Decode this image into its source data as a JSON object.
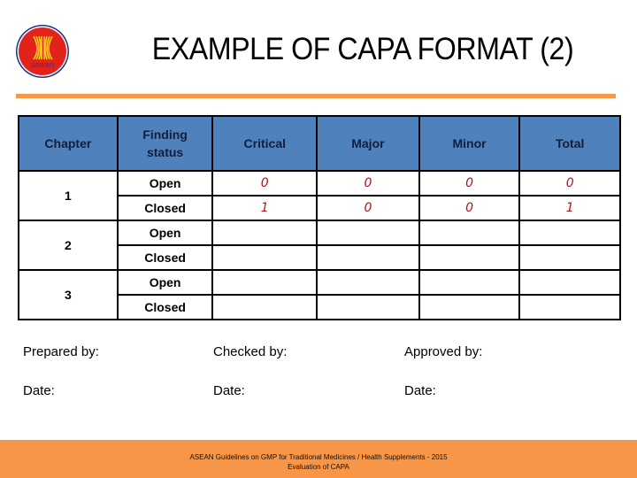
{
  "header": {
    "logo_text": "asean",
    "title": "EXAMPLE OF CAPA FORMAT (2)"
  },
  "colors": {
    "accent_orange": "#f79646",
    "table_header_blue": "#4f81bd",
    "value_red": "#b0141c"
  },
  "table": {
    "columns": [
      "Chapter",
      "Finding status",
      "Critical",
      "Major",
      "Minor",
      "Total"
    ],
    "column_header_lines": {
      "finding_status_1": "Finding",
      "finding_status_2": "status"
    },
    "rows": [
      {
        "chapter": "1",
        "status": "Open",
        "critical": "0",
        "major": "0",
        "minor": "0",
        "total": "0"
      },
      {
        "chapter": "1",
        "status": "Closed",
        "critical": "1",
        "major": "0",
        "minor": "0",
        "total": "1"
      },
      {
        "chapter": "2",
        "status": "Open",
        "critical": "",
        "major": "",
        "minor": "",
        "total": ""
      },
      {
        "chapter": "2",
        "status": "Closed",
        "critical": "",
        "major": "",
        "minor": "",
        "total": ""
      },
      {
        "chapter": "3",
        "status": "Open",
        "critical": "",
        "major": "",
        "minor": "",
        "total": ""
      },
      {
        "chapter": "3",
        "status": "Closed",
        "critical": "",
        "major": "",
        "minor": "",
        "total": ""
      }
    ]
  },
  "signatures": {
    "prepared_by": "Prepared by:",
    "checked_by": "Checked by:",
    "approved_by": "Approved by:",
    "date_label": "Date:"
  },
  "footer": {
    "line1": "ASEAN Guidelines on GMP for Traditional Medicines / Health Supplements - 2015",
    "line2": "Evaluation of CAPA"
  }
}
